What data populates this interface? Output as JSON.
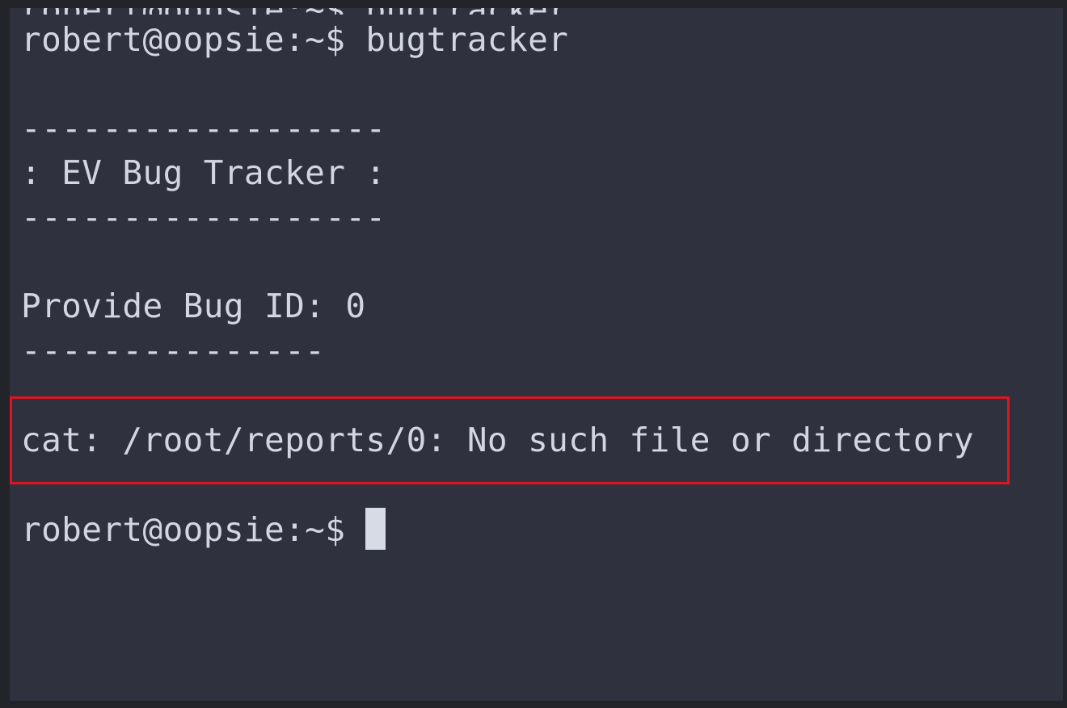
{
  "terminal": {
    "top_clipped_line": "robert@oopsie:~$ bugtracker",
    "lines": [
      "robert@oopsie:~$ bugtracker",
      "",
      "------------------",
      ": EV Bug Tracker :",
      "------------------",
      "",
      "Provide Bug ID: 0",
      "---------------",
      "",
      "cat: /root/reports/0: No such file or directory",
      "",
      "robert@oopsie:~$ "
    ]
  },
  "colors": {
    "background": "#2f323e",
    "text": "#d3d6e2",
    "highlight_border": "#e0141e",
    "cursor": "#d7dbe6"
  }
}
